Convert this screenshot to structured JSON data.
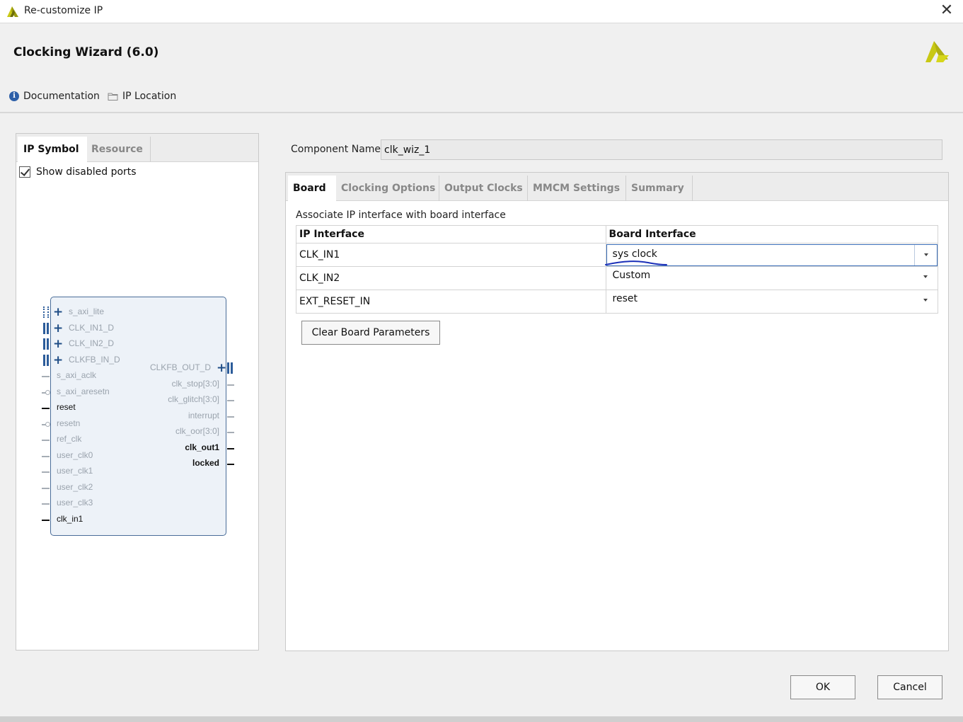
{
  "window": {
    "title": "Re-customize IP",
    "close_icon": "close-icon"
  },
  "header": {
    "wizard_name": "Clocking Wizard (6.0)",
    "links": [
      {
        "label": "Documentation",
        "icon": "info-icon"
      },
      {
        "label": "IP Location",
        "icon": "folder-icon"
      }
    ],
    "brand_color": "#c8c814"
  },
  "left": {
    "tabs": [
      {
        "label": "IP Symbol",
        "active": true
      },
      {
        "label": "Resource",
        "active": false
      }
    ],
    "show_disabled_ports": {
      "label": "Show disabled ports",
      "checked": true
    },
    "symbol": {
      "left_ports": [
        {
          "name": "s_axi_lite",
          "enabled": false,
          "type": "bus-dotted"
        },
        {
          "name": "CLK_IN1_D",
          "enabled": false,
          "type": "bus"
        },
        {
          "name": "CLK_IN2_D",
          "enabled": false,
          "type": "bus"
        },
        {
          "name": "CLKFB_IN_D",
          "enabled": false,
          "type": "bus"
        },
        {
          "name": "s_axi_aclk",
          "enabled": false,
          "type": "line"
        },
        {
          "name": "s_axi_aresetn",
          "enabled": false,
          "type": "inverted"
        },
        {
          "name": "reset",
          "enabled": true,
          "type": "line"
        },
        {
          "name": "resetn",
          "enabled": false,
          "type": "inverted"
        },
        {
          "name": "ref_clk",
          "enabled": false,
          "type": "line"
        },
        {
          "name": "user_clk0",
          "enabled": false,
          "type": "line"
        },
        {
          "name": "user_clk1",
          "enabled": false,
          "type": "line"
        },
        {
          "name": "user_clk2",
          "enabled": false,
          "type": "line"
        },
        {
          "name": "user_clk3",
          "enabled": false,
          "type": "line"
        },
        {
          "name": "clk_in1",
          "enabled": true,
          "type": "line"
        }
      ],
      "right_ports": [
        {
          "name": "CLKFB_OUT_D",
          "enabled": false,
          "type": "bus"
        },
        {
          "name": "clk_stop[3:0]",
          "enabled": false,
          "type": "line"
        },
        {
          "name": "clk_glitch[3:0]",
          "enabled": false,
          "type": "line"
        },
        {
          "name": "interrupt",
          "enabled": false,
          "type": "line"
        },
        {
          "name": "clk_oor[3:0]",
          "enabled": false,
          "type": "line"
        },
        {
          "name": "clk_out1",
          "enabled": true,
          "type": "line"
        },
        {
          "name": "locked",
          "enabled": true,
          "type": "line"
        }
      ]
    }
  },
  "component": {
    "label": "Component Name",
    "value": "clk_wiz_1"
  },
  "right": {
    "tabs": [
      {
        "label": "Board",
        "active": true
      },
      {
        "label": "Clocking Options",
        "active": false
      },
      {
        "label": "Output Clocks",
        "active": false
      },
      {
        "label": "MMCM Settings",
        "active": false
      },
      {
        "label": "Summary",
        "active": false
      }
    ],
    "board": {
      "caption": "Associate IP interface with board interface",
      "columns": [
        "IP Interface",
        "Board Interface"
      ],
      "rows": [
        {
          "ip": "CLK_IN1",
          "board": "sys clock"
        },
        {
          "ip": "CLK_IN2",
          "board": "Custom"
        },
        {
          "ip": "EXT_RESET_IN",
          "board": "reset"
        }
      ],
      "clear_button": "Clear Board Parameters"
    }
  },
  "footer": {
    "ok": "OK",
    "cancel": "Cancel"
  },
  "annotation_color": "#1a2fb8"
}
